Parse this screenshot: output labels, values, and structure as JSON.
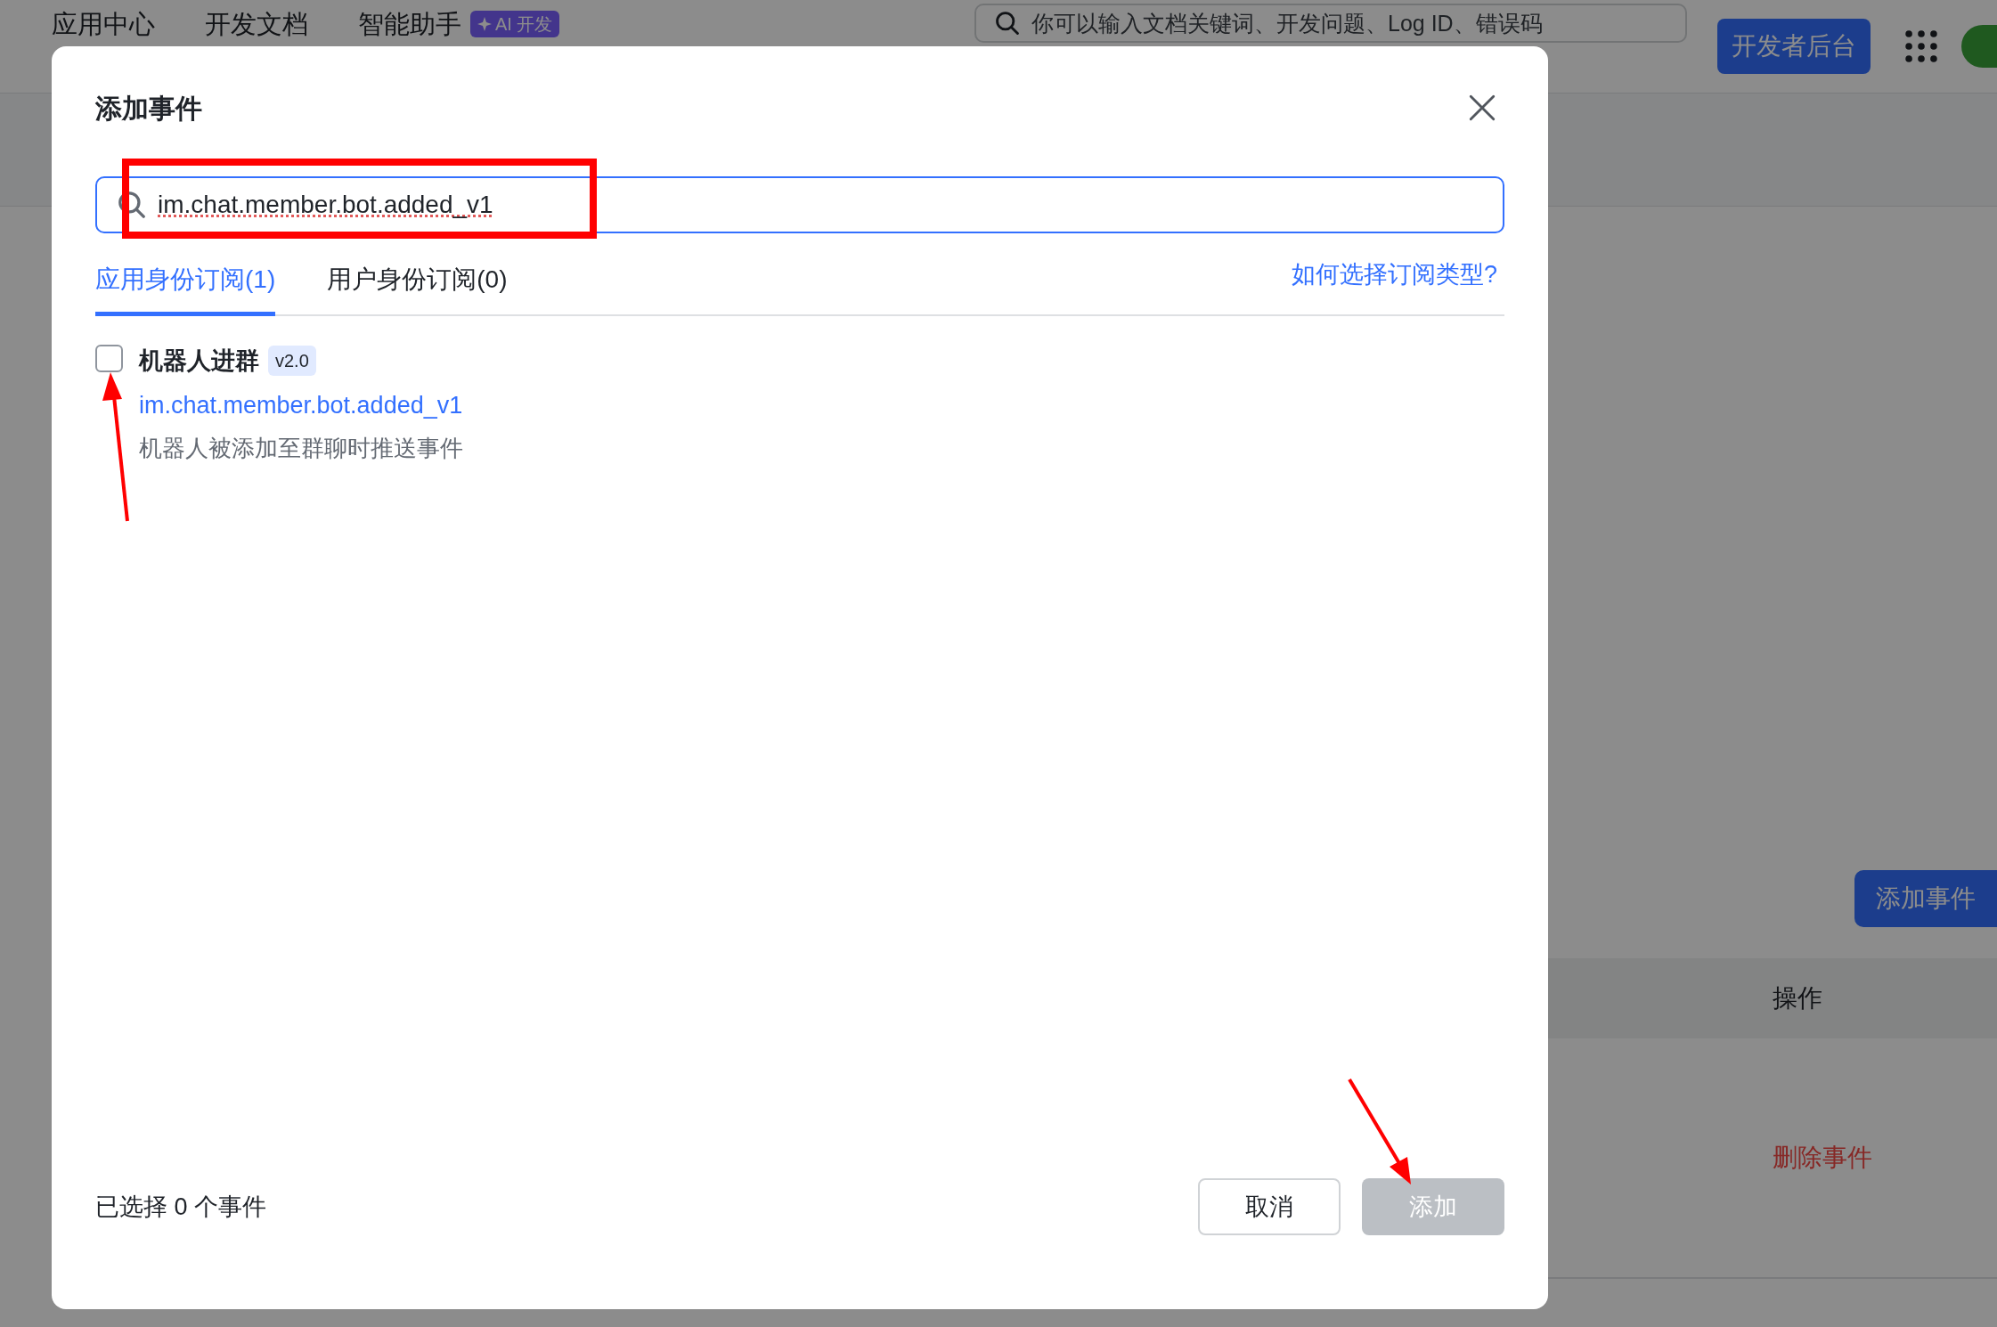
{
  "top_nav": {
    "links": [
      {
        "label": "应用中心"
      },
      {
        "label": "开发文档"
      },
      {
        "label": "智能助手"
      }
    ],
    "ai_badge": "AI 开发",
    "search": {
      "placeholder": "你可以输入文档关键词、开发问题、Log ID、错误码"
    },
    "console_button": "开发者后台"
  },
  "page": {
    "add_event_button": "添加事件",
    "table": {
      "columns": [
        {
          "label": "操作"
        }
      ],
      "rows": [
        {
          "action": "删除事件"
        }
      ]
    }
  },
  "dialog": {
    "title": "添加事件",
    "search": {
      "value": "im.chat.member.bot.added_v1"
    },
    "tabs": [
      {
        "label": "应用身份订阅(1)",
        "selected": true
      },
      {
        "label": "用户身份订阅(0)",
        "selected": false
      }
    ],
    "help_link": "如何选择订阅类型?",
    "events": [
      {
        "name": "机器人进群",
        "version": "v2.0",
        "key": "im.chat.member.bot.added_v1",
        "description": "机器人被添加至群聊时推送事件",
        "checked": false
      }
    ],
    "selection_summary": "已选择 0 个事件",
    "cancel_button": "取消",
    "add_button": {
      "label": "添加",
      "disabled": true
    }
  }
}
